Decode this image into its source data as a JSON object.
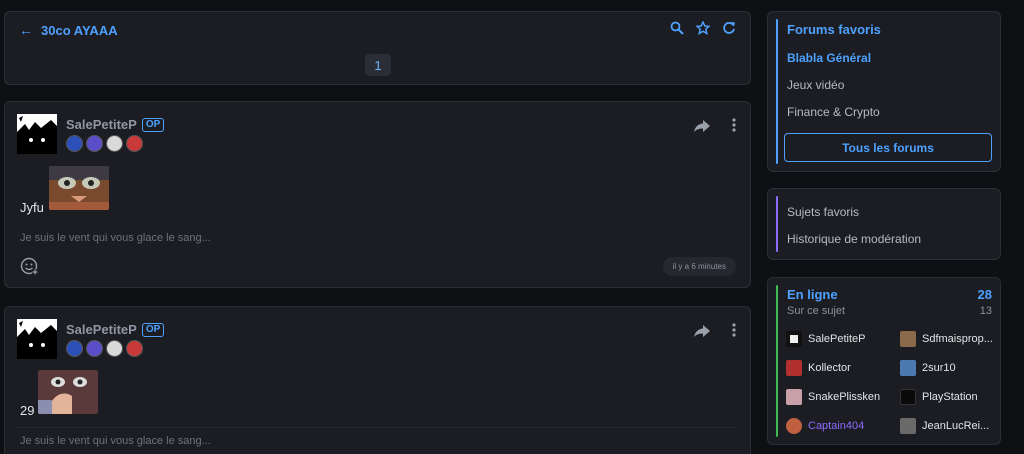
{
  "topic": {
    "back_title": "30co AYAAA",
    "page": "1"
  },
  "icons": {
    "back": "arrow-left-icon",
    "search": "search-icon",
    "favorite": "star-icon",
    "refresh": "refresh-icon",
    "share": "share-icon",
    "more": "more-vertical-icon",
    "react": "emoji-add-icon"
  },
  "posts": [
    {
      "author": "SalePetiteP",
      "op": "OP",
      "text": "Jyfu",
      "signature": "Je suis le vent qui vous glace le sang...",
      "time": "il y a 6 minutes"
    },
    {
      "author": "SalePetiteP",
      "op": "OP",
      "text": "29",
      "signature": "Je suis le vent qui vous glace le sang..."
    }
  ],
  "fav_forums": {
    "title": "Forums favoris",
    "items": [
      "Blabla Général",
      "Jeux vidéo",
      "Finance & Crypto"
    ],
    "all_button": "Tous les forums"
  },
  "fav_topics": {
    "items": [
      "Sujets favoris",
      "Historique de modération"
    ]
  },
  "online": {
    "title": "En ligne",
    "count": "28",
    "subtitle": "Sur ce sujet",
    "subcount": "13",
    "users": [
      "SalePetiteP",
      "Sdfmaisprop...",
      "Kollector",
      "2sur10",
      "SnakePlissken",
      "PlayStation",
      "Captain404",
      "JeanLucRei..."
    ]
  },
  "colors": {
    "accent": "#4ea1ff",
    "card": "#1b1d22",
    "background": "#0f1014",
    "bar_forums": "#4ea1ff",
    "bar_topics": "#8e6bff",
    "bar_online": "#3fb950",
    "highlight_user": "#8e6bff"
  }
}
